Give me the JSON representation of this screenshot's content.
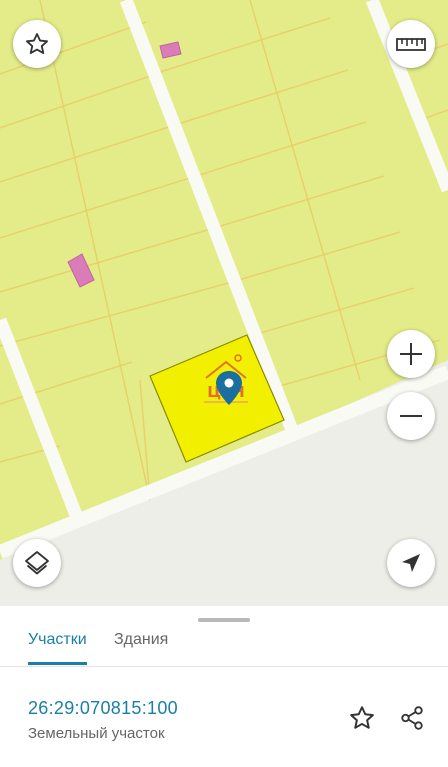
{
  "map": {
    "parcel_fill": "#e3ec88",
    "boundary_color": "#e8cf6a",
    "road_color": "#fafaf4",
    "selected_fill": "#f2f000",
    "building_color": "#d97cb8",
    "marker_color": "#1a6fa0",
    "watermark": "ЦРН",
    "controls": {
      "favorite": "star-icon",
      "ruler": "ruler-icon",
      "zoom_in": "plus-icon",
      "zoom_out": "minus-icon",
      "layers": "layers-icon",
      "locate": "navigation-arrow-icon"
    }
  },
  "sheet": {
    "tabs": [
      {
        "label": "Участки",
        "active": true
      },
      {
        "label": "Здания",
        "active": false
      }
    ],
    "cadastral_number": "26:29:070815:100",
    "object_type": "Земельный участок",
    "actions": [
      "star-icon",
      "share-icon"
    ]
  },
  "colors": {
    "accent": "#1a7fa8",
    "secondary_text": "#666666"
  }
}
